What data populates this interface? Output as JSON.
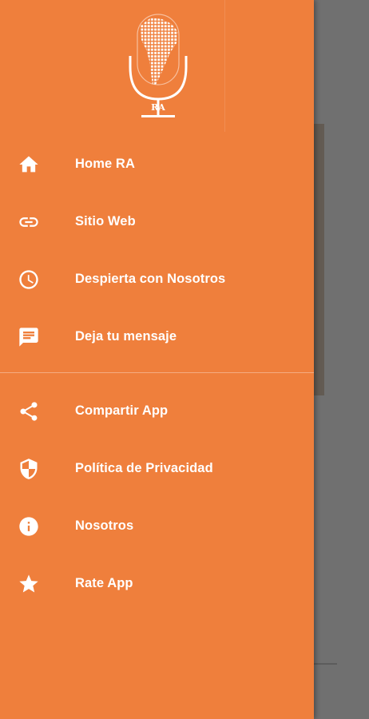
{
  "colors": {
    "drawer": "#ef7f3c",
    "scrim": "#707070",
    "text": "#ffffff"
  },
  "logo": {
    "text": "RA",
    "icon": "microphone-south-america-icon"
  },
  "menu": {
    "primary": [
      {
        "label": "Home RA",
        "icon": "home-icon"
      },
      {
        "label": "Sitio Web",
        "icon": "link-icon"
      },
      {
        "label": "Despierta con Nosotros",
        "icon": "clock-icon"
      },
      {
        "label": "Deja tu mensaje",
        "icon": "message-icon"
      }
    ],
    "secondary": [
      {
        "label": "Compartir App",
        "icon": "share-icon"
      },
      {
        "label": "Política de Privacidad",
        "icon": "shield-icon"
      },
      {
        "label": "Nosotros",
        "icon": "info-icon"
      },
      {
        "label": "Rate App",
        "icon": "star-icon"
      }
    ]
  }
}
